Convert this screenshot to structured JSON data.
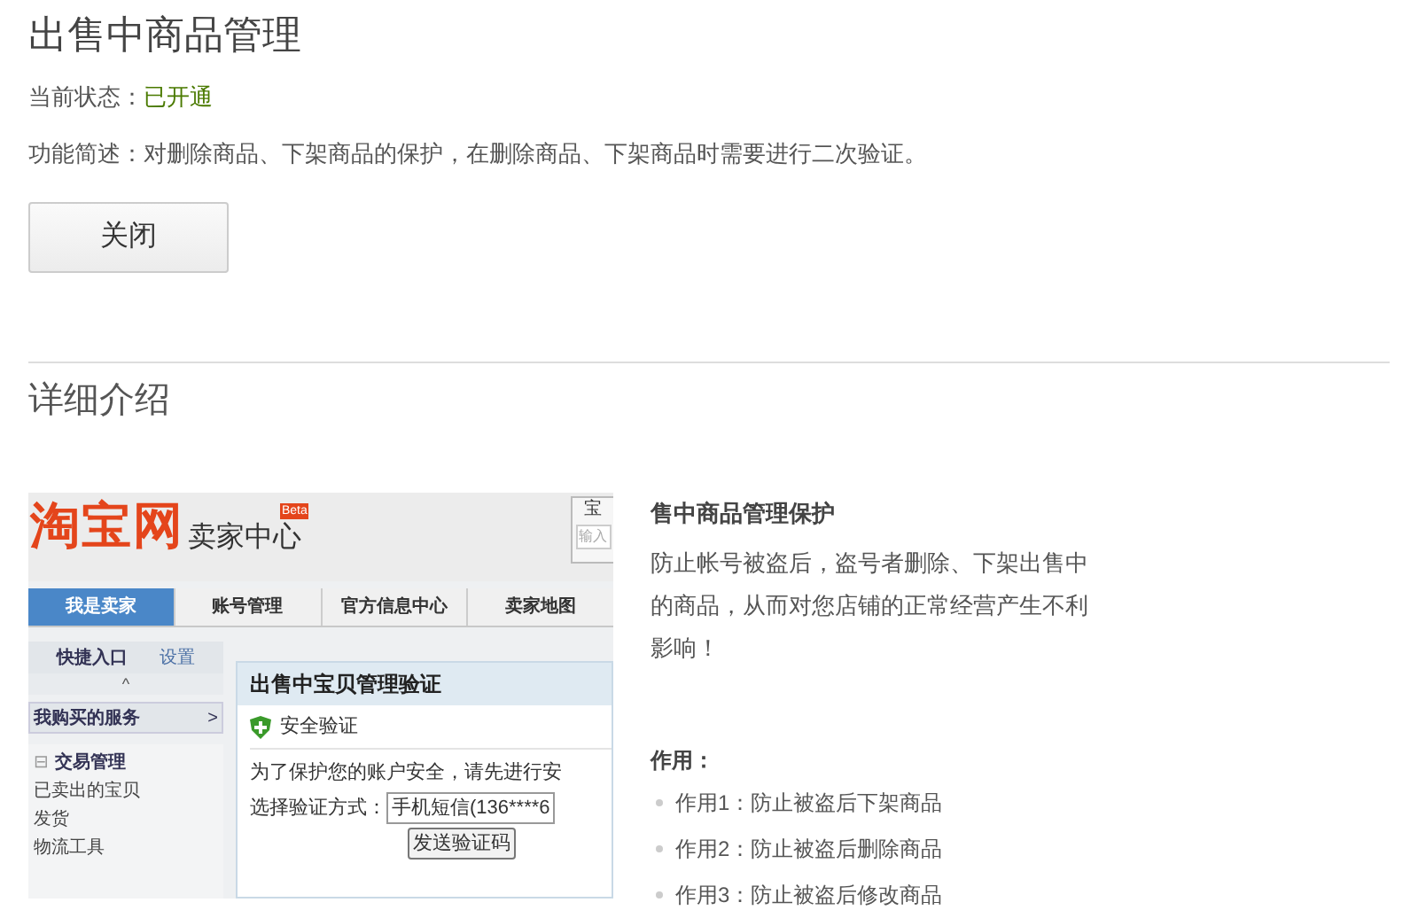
{
  "title": "出售中商品管理",
  "status": {
    "label": "当前状态：",
    "value": "已开通"
  },
  "description": "功能简述：对删除商品、下架商品的保护，在删除商品、下架商品时需要进行二次验证。",
  "close_button": "关闭",
  "section_title": "详细介绍",
  "embedded_screen": {
    "logo": "淘宝网",
    "logo_sub": "卖家中心",
    "badge": "Beta",
    "corner_text": "宝",
    "corner_field": "输入",
    "tabs": [
      {
        "label": "我是卖家",
        "selected": true
      },
      {
        "label": "账号管理",
        "selected": false
      },
      {
        "label": "官方信息中心",
        "selected": false
      },
      {
        "label": "卖家地图",
        "selected": false
      }
    ],
    "sidebar": {
      "shortcut": "快捷入口",
      "settings": "设置",
      "collapse": "^",
      "services": "我购买的服务",
      "services_arrow": ">",
      "group_toggle": "⊟",
      "group": "交易管理",
      "items": [
        "已卖出的宝贝",
        "发货",
        "物流工具"
      ]
    },
    "dialog": {
      "title": "出售中宝贝管理验证",
      "section": "安全验证",
      "message": "为了保护您的账户安全，请先进行安",
      "method_label": "选择验证方式：",
      "method_value": "手机短信(136****6",
      "send_button": "发送验证码"
    }
  },
  "info": {
    "heading": "售中商品管理保护",
    "body": "防止帐号被盗后，盗号者删除、下架出售中的商品，从而对您店铺的正常经营产生不利影响！",
    "uses_title": "作用：",
    "uses": [
      "作用1：防止被盗后下架商品",
      "作用2：防止被盗后删除商品",
      "作用3：防止被盗后修改商品"
    ]
  }
}
